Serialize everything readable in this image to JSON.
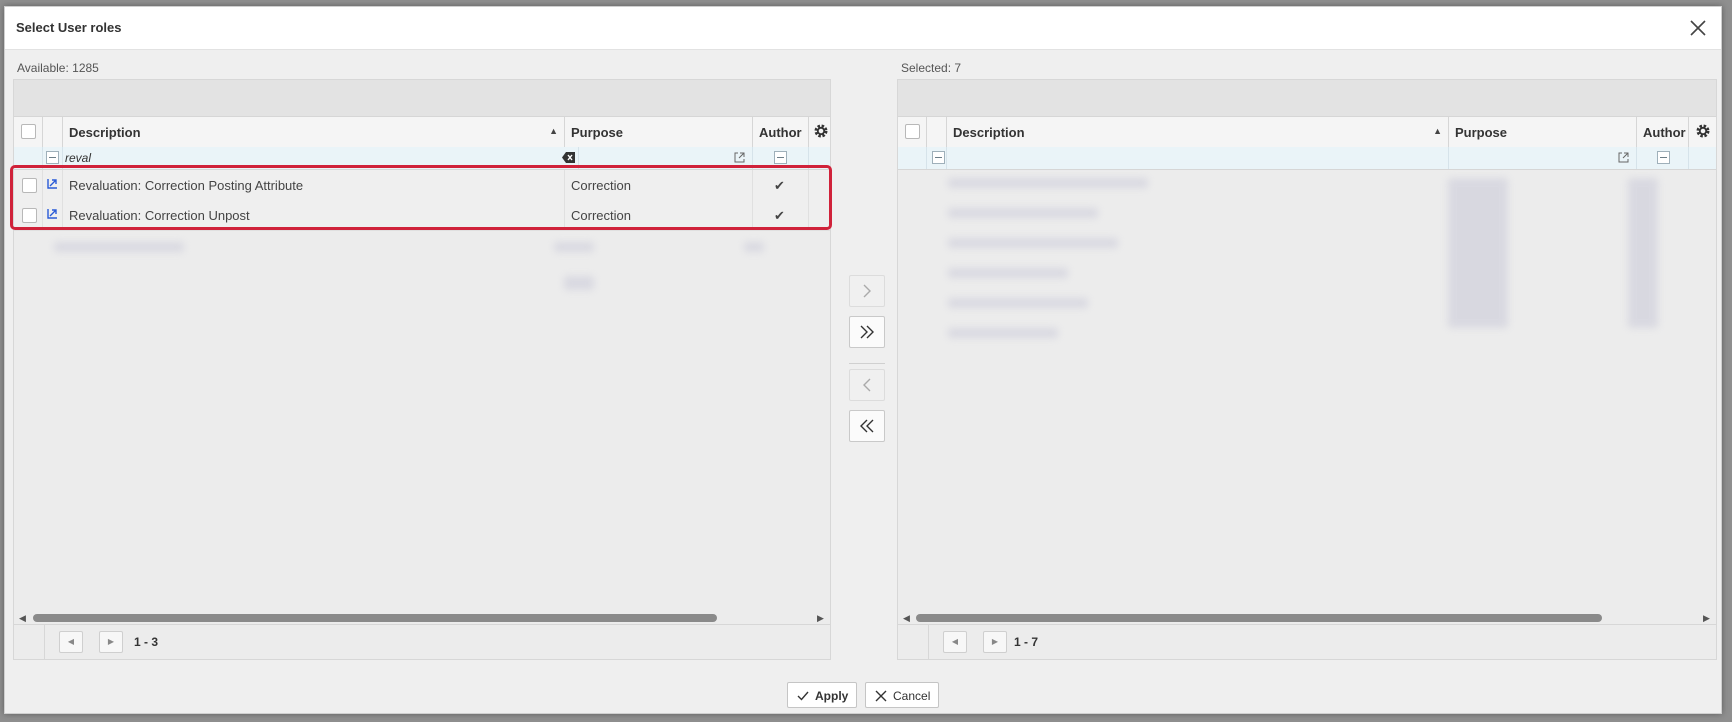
{
  "dialog": {
    "title": "Select User roles"
  },
  "available": {
    "count_label": "Available: 1285",
    "columns": {
      "description": "Description",
      "purpose": "Purpose",
      "author": "Author"
    },
    "filter": {
      "description_value": "reval"
    },
    "rows": [
      {
        "description": "Revaluation: Correction Posting Attribute",
        "purpose": "Correction",
        "author_checked": true
      },
      {
        "description": "Revaluation: Correction Unpost",
        "purpose": "Correction",
        "author_checked": true
      }
    ],
    "pager_text": "1 - 3"
  },
  "selected": {
    "count_label": "Selected: 7",
    "columns": {
      "description": "Description",
      "purpose": "Purpose",
      "author": "Author"
    },
    "filter": {
      "description_value": ""
    },
    "pager_text": "1 - 7"
  },
  "buttons": {
    "apply": "Apply",
    "cancel": "Cancel"
  },
  "colors": {
    "highlight": "#d0223a",
    "row_icon": "#2a5bd7"
  },
  "icons": [
    "close-icon",
    "gear-icon",
    "sort-ascending-icon",
    "popout-icon",
    "clear-filter-icon",
    "chevron-right-icon",
    "double-chevron-right-icon",
    "chevron-left-icon",
    "double-chevron-left-icon",
    "checkmark-icon",
    "x-icon"
  ]
}
